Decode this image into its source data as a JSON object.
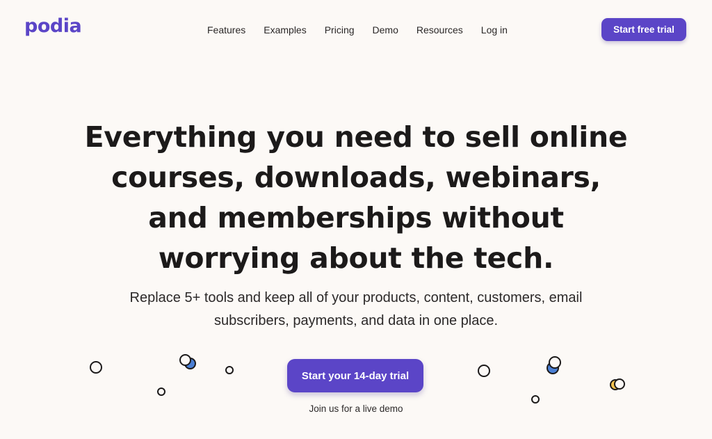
{
  "brand": {
    "logo_text": "podia",
    "accent": "#5b45c7"
  },
  "nav": {
    "items": [
      {
        "label": "Features"
      },
      {
        "label": "Examples"
      },
      {
        "label": "Pricing"
      },
      {
        "label": "Demo"
      },
      {
        "label": "Resources"
      },
      {
        "label": "Log in"
      }
    ],
    "cta_label": "Start free trial"
  },
  "hero": {
    "title": "Everything you need to sell online courses, downloads, webinars, and memberships without worrying about the tech.",
    "subtitle": "Replace 5+ tools and keep all of your products, content, customers, email subscribers, payments, and data in one place.",
    "cta_label": "Start your 14-day trial",
    "demo_link": "Join us for a live demo"
  },
  "decor": {
    "bubble_colors": {
      "outline": "#1c1a1a",
      "blue": "#4a7fd4",
      "yellow": "#f2c14e"
    }
  }
}
